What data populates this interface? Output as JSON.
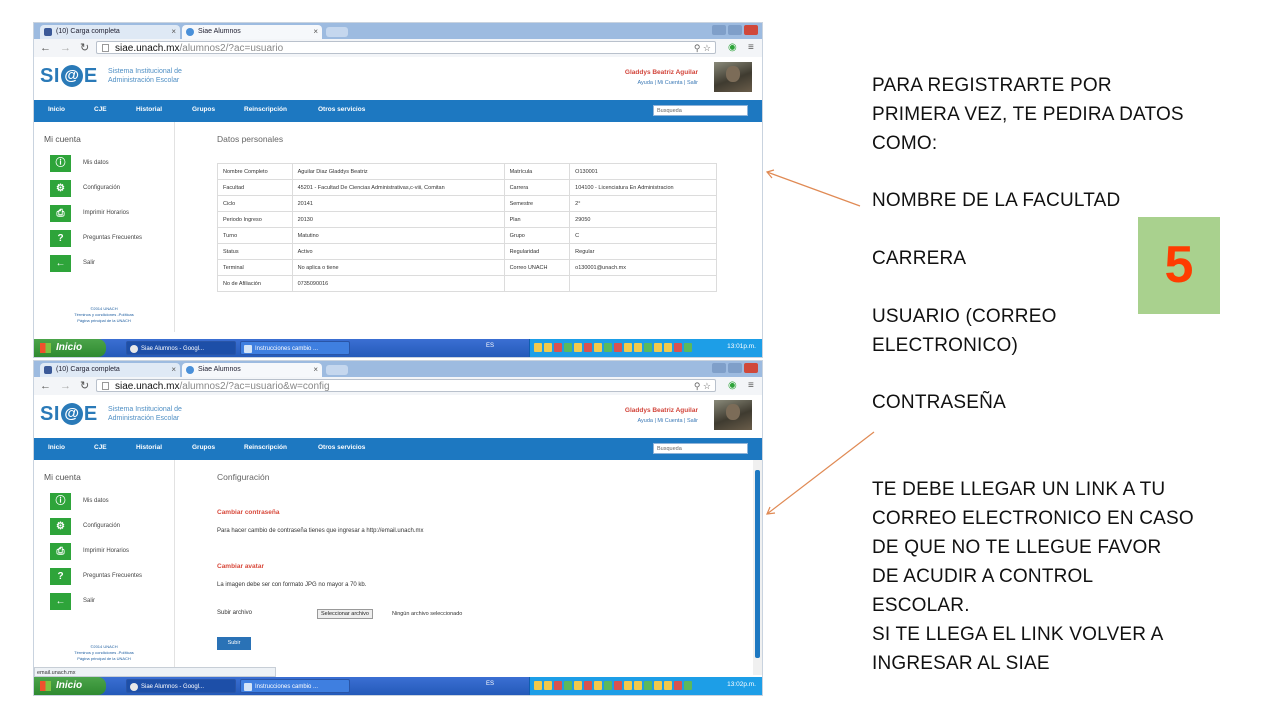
{
  "screens": [
    {
      "tabs": [
        {
          "label": "(10) Carga completa"
        },
        {
          "label": "Siae Alumnos"
        }
      ],
      "url_host": "siae.unach.mx",
      "url_path": "/alumnos2/?ac=usuario",
      "header": {
        "logo": "SI@E",
        "logo_subtitle_1": "Sistema Institucional de",
        "logo_subtitle_2": "Administración Escolar",
        "user_name": "Gladdys Beatriz Aguilar",
        "user_links": "Ayuda  |  Mi Cuenta  |  Salir"
      },
      "menu": [
        "Inicio",
        "CJE",
        "Historial",
        "Grupos",
        "Reinscripción",
        "Otros servicios"
      ],
      "search_placeholder": "Busqueda",
      "sidebar": {
        "title": "Mi cuenta",
        "items": [
          {
            "icon": "info-icon",
            "glyph": "ⓘ",
            "label": "Mis datos"
          },
          {
            "icon": "gear-icon",
            "glyph": "⚙",
            "label": "Configuración"
          },
          {
            "icon": "printer-icon",
            "glyph": "⎙",
            "label": "Imprimir Horarios"
          },
          {
            "icon": "question-icon",
            "glyph": "?",
            "label": "Preguntas Frecuentes"
          },
          {
            "icon": "exit-arrow-icon",
            "glyph": "←",
            "label": "Salir"
          }
        ],
        "footer_1": "©2014 UNACH",
        "footer_2": "Términos y condiciones -Políticas",
        "footer_3": "Página principal de la UNACH"
      },
      "content_title": "Datos personales",
      "table": [
        [
          "Nombre Completo",
          "Aguilar Diaz Gladdys Beatriz",
          "Matrícula",
          "O130001"
        ],
        [
          "Facultad",
          "45201 - Facultad De Ciencias Administrativas,c-viii, Comitan",
          "Carrera",
          "104100 - Licenciatura En Administracion"
        ],
        [
          "Ciclo",
          "20141",
          "Semestre",
          "2°"
        ],
        [
          "Periodo Ingreso",
          "20130",
          "Plan",
          "29050"
        ],
        [
          "Turno",
          "Matutino",
          "Grupo",
          "C"
        ],
        [
          "Status",
          "Activo",
          "Regularidad",
          "Regular"
        ],
        [
          "Terminal",
          "No aplica o tiene",
          "Correo UNACH",
          "o130001@unach.mx"
        ],
        [
          "No de Afiliación",
          "0735090016",
          "",
          ""
        ]
      ],
      "taskbar": {
        "start": "Inicio",
        "tasks": [
          "Siae Alumnos - Googl...",
          "Instrucciones cambio ..."
        ],
        "lang": "ES",
        "clock": "13:01p.m."
      }
    },
    {
      "tabs": [
        {
          "label": "(10) Carga completa"
        },
        {
          "label": "Siae Alumnos"
        }
      ],
      "url_host": "siae.unach.mx",
      "url_path": "/alumnos2/?ac=usuario&w=config",
      "header": {
        "logo": "SI@E",
        "logo_subtitle_1": "Sistema Institucional de",
        "logo_subtitle_2": "Administración Escolar",
        "user_name": "Gladdys Beatriz Aguilar",
        "user_links": "Ayuda  |  Mi Cuenta  |  Salir"
      },
      "menu": [
        "Inicio",
        "CJE",
        "Historial",
        "Grupos",
        "Reinscripción",
        "Otros servicios"
      ],
      "search_placeholder": "Busqueda",
      "sidebar": {
        "title": "Mi cuenta",
        "items": [
          {
            "icon": "info-icon",
            "glyph": "ⓘ",
            "label": "Mis datos"
          },
          {
            "icon": "gear-icon",
            "glyph": "⚙",
            "label": "Configuración"
          },
          {
            "icon": "printer-icon",
            "glyph": "⎙",
            "label": "Imprimir Horarios"
          },
          {
            "icon": "question-icon",
            "glyph": "?",
            "label": "Preguntas Frecuentes"
          },
          {
            "icon": "exit-arrow-icon",
            "glyph": "←",
            "label": "Salir"
          }
        ],
        "footer_1": "©2014 UNACH",
        "footer_2": "Términos y condiciones -Políticas",
        "footer_3": "Página principal de la UNACH"
      },
      "content_title": "Configuración",
      "config": {
        "section_password": "Cambiar contraseña",
        "password_text": "Para hacer cambio de contraseña tienes que ingresar a http://email.unach.mx",
        "section_avatar": "Cambiar avatar",
        "avatar_text": "La imagen debe ser con formato JPG no mayor a 70 kb.",
        "upload_label": "Subir archivo",
        "file_button": "Seleccionar archivo",
        "file_none": "Ningún archivo seleccionado",
        "submit": "Subir"
      },
      "status_url": "email.unach.mx",
      "taskbar": {
        "start": "Inicio",
        "tasks": [
          "Siae Alumnos - Googl...",
          "Instrucciones cambio ..."
        ],
        "lang": "ES",
        "clock": "13:02p.m."
      }
    }
  ],
  "instructions": {
    "block1": [
      "PARA REGISTRARTE POR",
      "PRIMERA VEZ, TE PEDIRA DATOS",
      "COMO:"
    ],
    "item_facultad": "NOMBRE DE LA FACULTAD",
    "item_carrera": "CARRERA",
    "item_usuario": [
      "USUARIO (CORREO",
      "ELECTRONICO)"
    ],
    "item_contrasena": "CONTRASEÑA",
    "block2": [
      "TE DEBE LLEGAR UN LINK A TU",
      "CORREO ELECTRONICO EN CASO",
      "DE QUE NO TE LLEGUE FAVOR",
      "DE ACUDIR A CONTROL",
      "ESCOLAR.",
      "SI TE LLEGA EL LINK VOLVER A",
      "INGRESAR AL SIAE"
    ]
  },
  "step_number": "5",
  "colors": {
    "siae_blue": "#1d78c1",
    "icon_green": "#2ea43a",
    "accent_red": "#d84a3c",
    "step_box": "#a9d18e",
    "step_number": "#ff3c00",
    "arrow": "#e08a54"
  }
}
